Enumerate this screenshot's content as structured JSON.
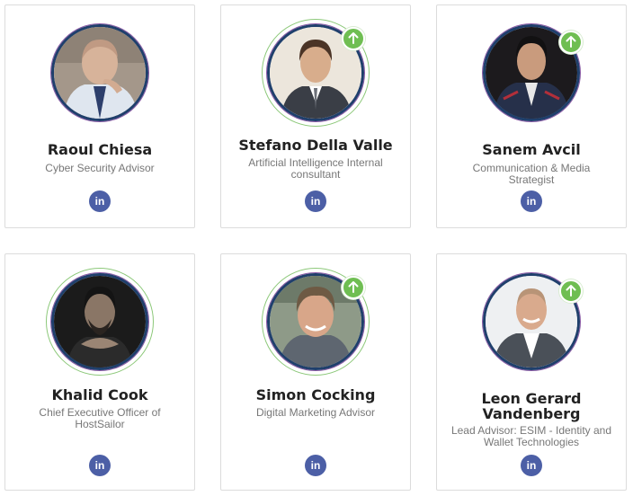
{
  "team": [
    {
      "name": "Raoul Chiesa",
      "role": "Cyber Security Advisor",
      "badge": false,
      "social": "in"
    },
    {
      "name": "Stefano Della Valle",
      "role": "Artificial Intelligence Internal consultant",
      "badge": true,
      "social": "in"
    },
    {
      "name": "Sanem Avcil",
      "role": "Communication & Media Strategist",
      "badge": true,
      "social": "in"
    },
    {
      "name": "Khalid Cook",
      "role": "Chief Executive Officer of HostSailor",
      "badge": false,
      "social": "in"
    },
    {
      "name": "Simon Cocking",
      "role": "Digital Marketing Advisor",
      "badge": true,
      "social": "in"
    },
    {
      "name": "Leon Gerard Vandenberg",
      "role": "Lead Advisor: ESIM - Identity and Wallet Technologies",
      "badge": true,
      "social": "in"
    }
  ],
  "icons": {
    "badge": "arrow-up-icon",
    "social": "linkedin-icon"
  },
  "colors": {
    "badge_green": "#6fbe52",
    "linkedin_blue": "#4c5fa6",
    "avatar_border": "#1f3f6c",
    "ring_green": "#8cc879"
  }
}
